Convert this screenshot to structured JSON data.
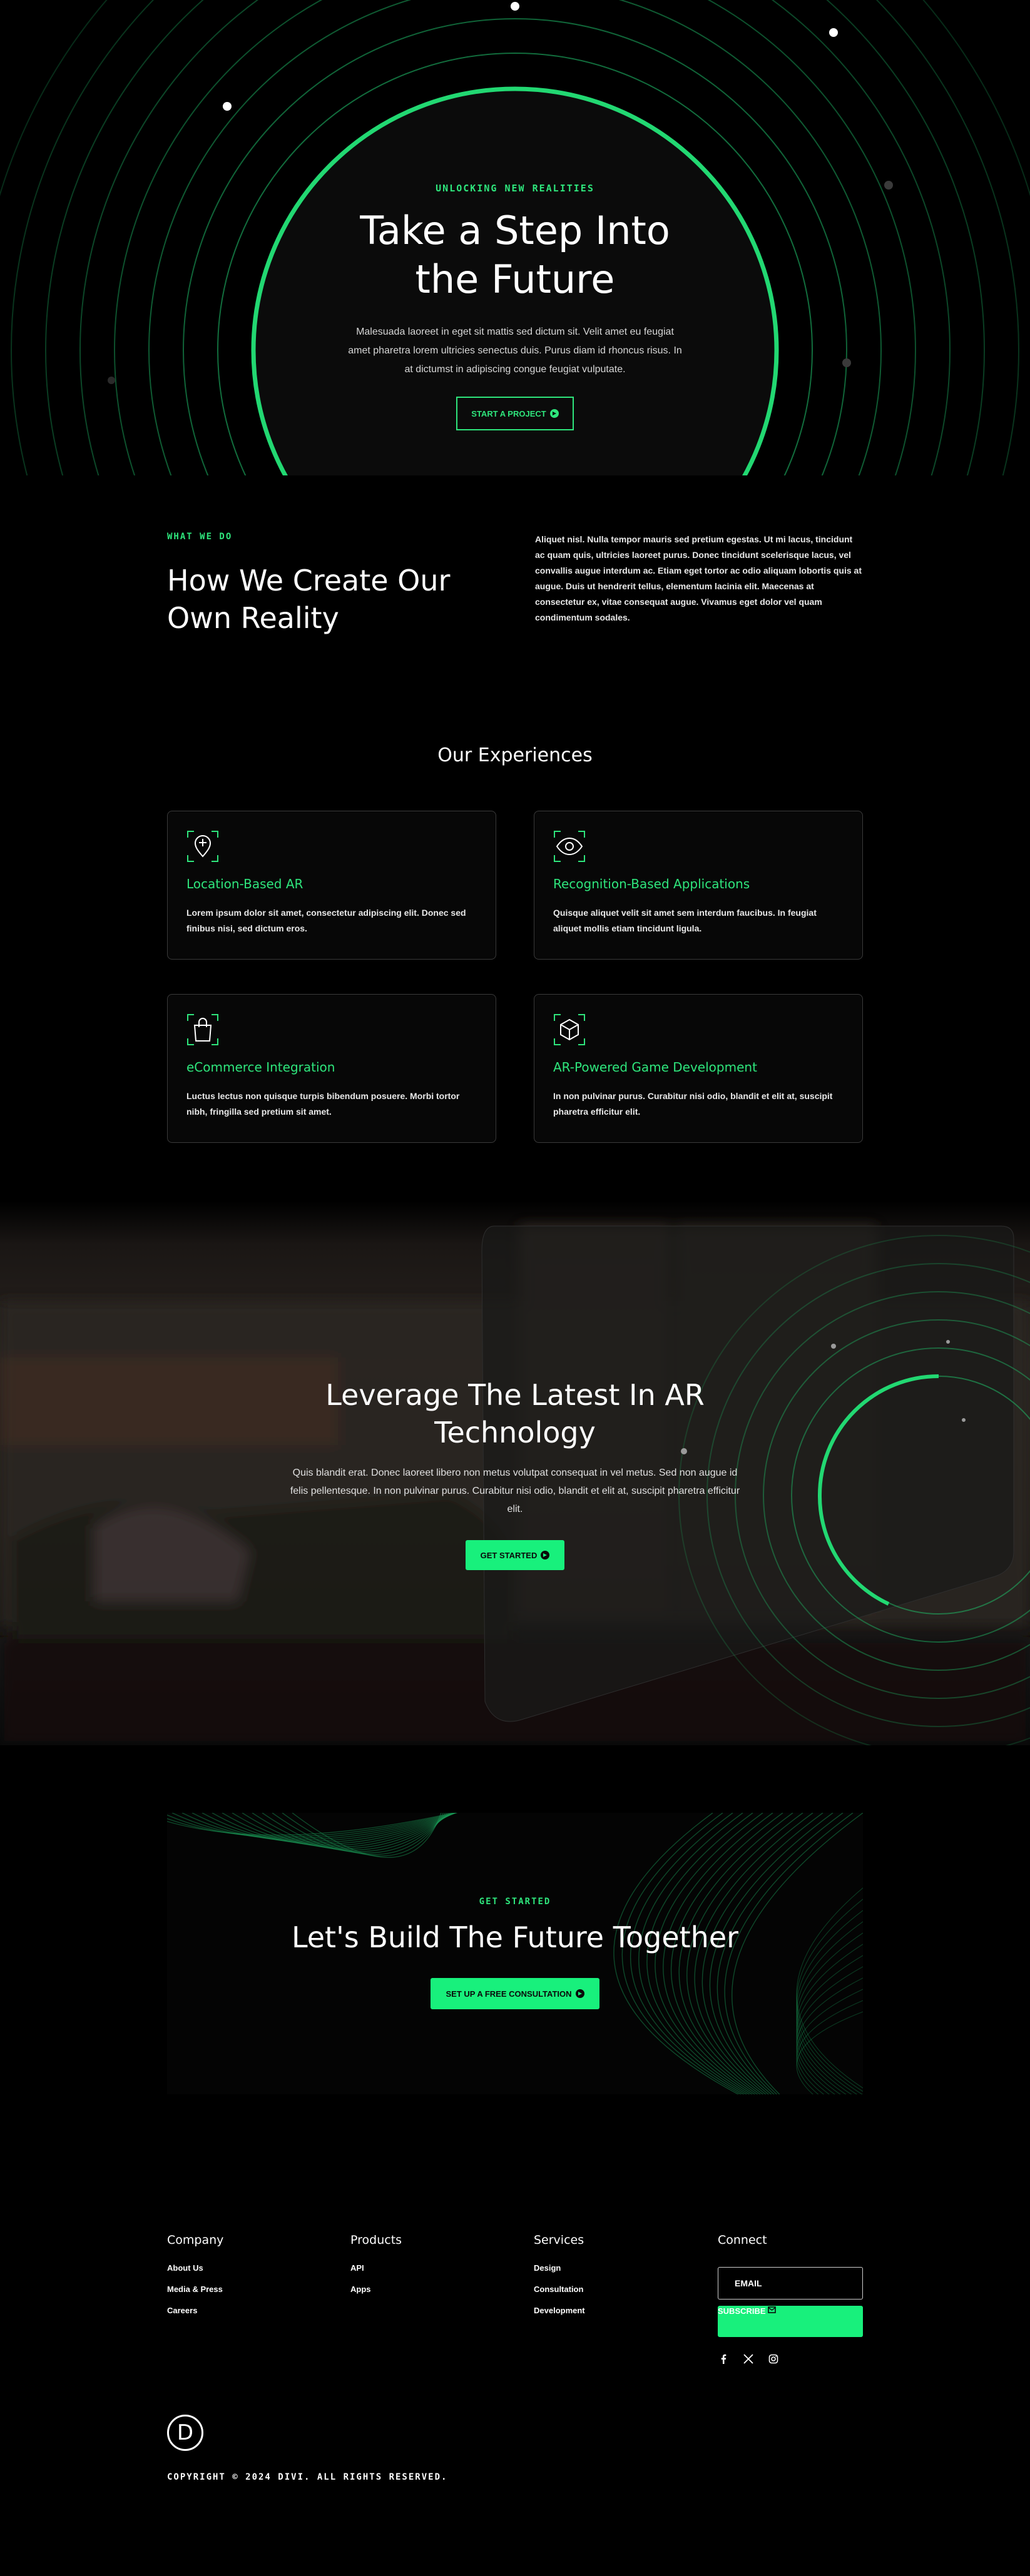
{
  "colors": {
    "accent": "#2ee57c",
    "button": "#18f07c",
    "background": "#000000"
  },
  "hero": {
    "eyebrow": "UNLOCKING NEW REALITIES",
    "title": "Take a Step Into the Future",
    "body": "Malesuada laoreet in eget sit mattis sed dictum sit. Velit amet eu feugiat amet pharetra lorem ultricies senectus duis. Purus diam id rhoncus risus. In at dictumst in adipiscing congue feugiat vulputate.",
    "cta_label": "START A PROJECT",
    "cta_icon": "arrow-circle-icon"
  },
  "what_we_do": {
    "eyebrow": "WHAT WE DO",
    "title": "How We Create Our Own Reality",
    "body": "Aliquet nisl. Nulla tempor mauris sed pretium egestas. Ut mi lacus, tincidunt ac quam quis, ultricies laoreet purus. Donec tincidunt scelerisque lacus, vel convallis augue interdum ac. Etiam eget tortor ac odio aliquam lobortis quis at augue. Duis ut hendrerit tellus, elementum lacinia elit. Maecenas at consectetur ex, vitae consequat augue. Vivamus eget dolor vel quam condimentum sodales."
  },
  "experiences": {
    "title": "Our Experiences",
    "cards": [
      {
        "icon": "location-pin-icon",
        "title": "Location-Based AR",
        "body": "Lorem ipsum dolor sit amet, consectetur adipiscing elit. Donec sed finibus nisi, sed dictum eros."
      },
      {
        "icon": "eye-scan-icon",
        "title": "Recognition-Based Applications",
        "body": "Quisque aliquet velit sit amet sem interdum faucibus. In feugiat aliquet mollis etiam tincidunt ligula."
      },
      {
        "icon": "shopping-bag-icon",
        "title": "eCommerce Integration",
        "body": "Luctus lectus non quisque turpis bibendum posuere. Morbi tortor nibh, fringilla sed pretium sit amet."
      },
      {
        "icon": "cube-icon",
        "title": "AR-Powered Game Development",
        "body": "In non pulvinar purus. Curabitur nisi odio, blandit et elit at, suscipit pharetra efficitur elit."
      }
    ]
  },
  "leverage": {
    "title": "Leverage The Latest In AR Technology",
    "body": "Quis blandit erat. Donec laoreet libero non metus volutpat consequat in vel metus. Sed non augue id felis pellentesque. In non pulvinar purus. Curabitur nisi odio, blandit et elit at, suscipit pharetra efficitur elit.",
    "cta_label": "GET STARTED"
  },
  "get_started": {
    "eyebrow": "GET STARTED",
    "title": "Let's Build The Future Together",
    "cta_label": "SET UP A FREE CONSULTATION"
  },
  "footer": {
    "company": {
      "heading": "Company",
      "links": [
        "About Us",
        "Media & Press",
        "Careers"
      ]
    },
    "products": {
      "heading": "Products",
      "links": [
        "API",
        "Apps"
      ]
    },
    "services": {
      "heading": "Services",
      "links": [
        "Design",
        "Consultation",
        "Development"
      ]
    },
    "connect": {
      "heading": "Connect",
      "email_placeholder": "EMAIL",
      "subscribe_label": "SUBSCRIBE",
      "social_icons": [
        "facebook-icon",
        "x-icon",
        "instagram-icon"
      ]
    },
    "logo_letter": "D",
    "copyright": "COPYRIGHT © 2024 DIVI. ALL RIGHTS RESERVED."
  }
}
